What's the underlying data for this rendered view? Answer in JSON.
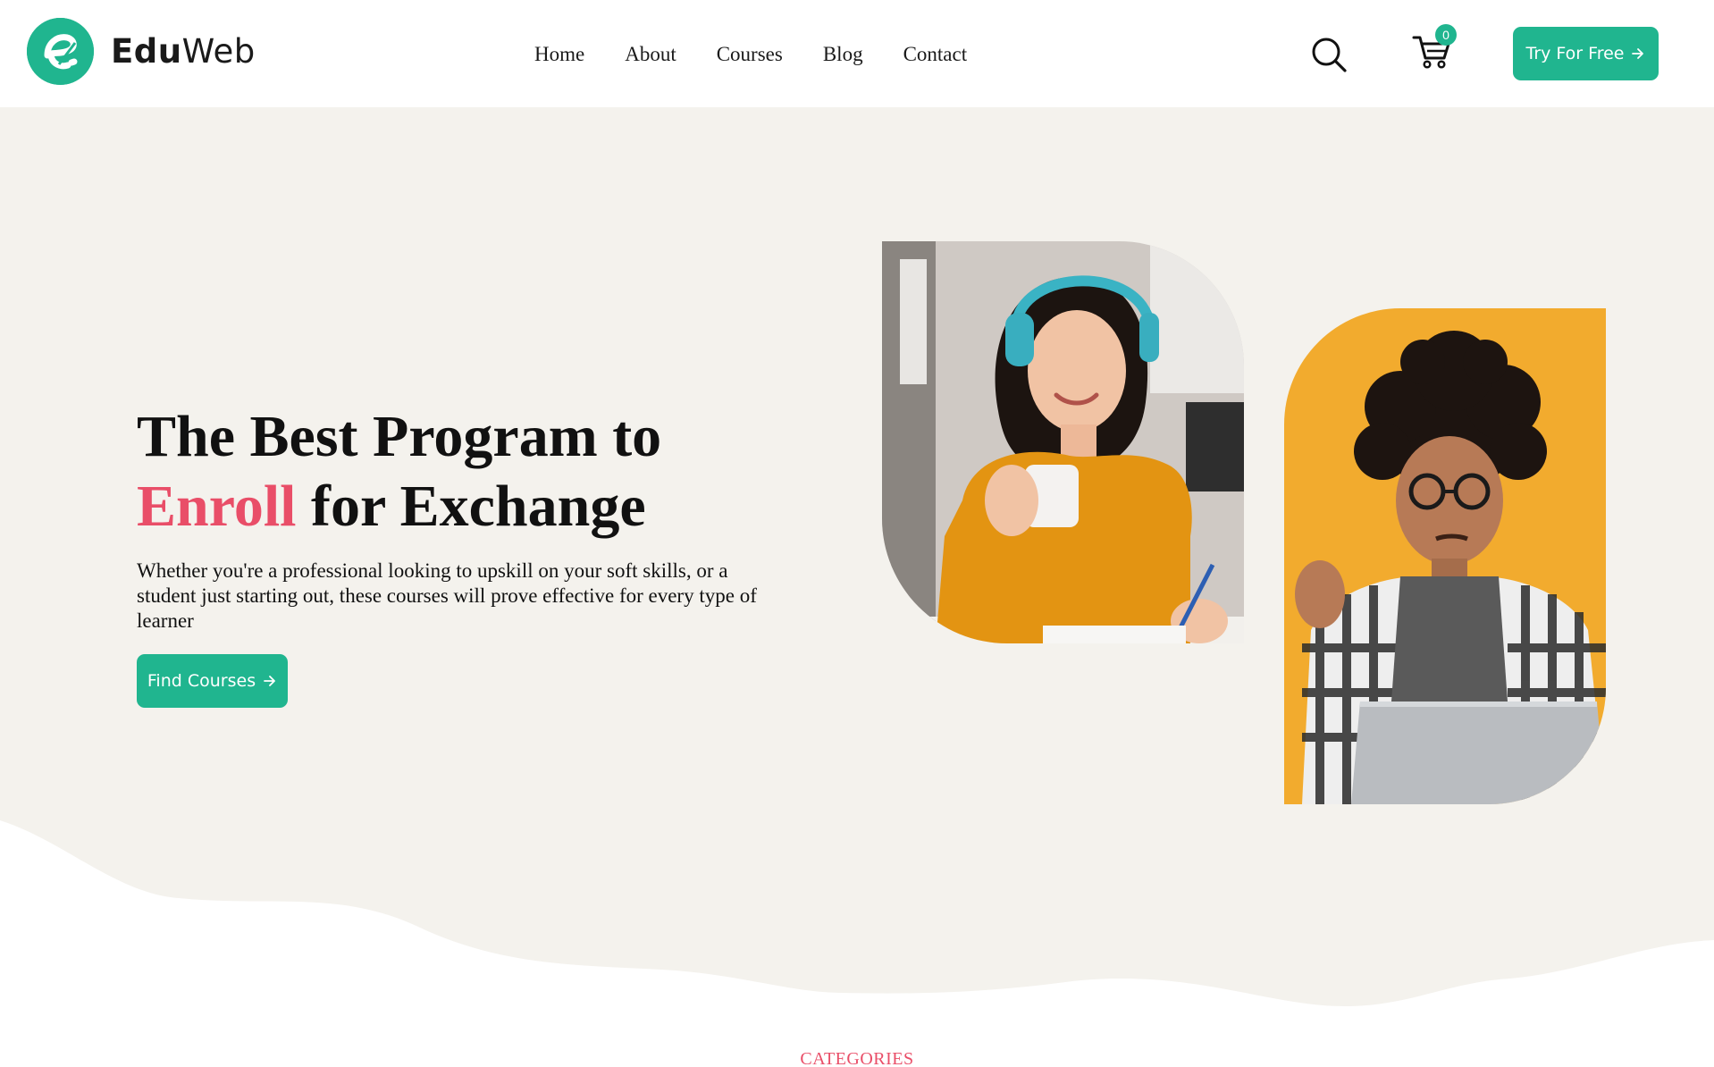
{
  "brand": {
    "name_bold": "Edu",
    "name_light": "Web",
    "logo_letter": "e",
    "accent_color": "#20b58f"
  },
  "nav": {
    "items": [
      "Home",
      "About",
      "Courses",
      "Blog",
      "Contact"
    ]
  },
  "header": {
    "search_icon": "search-icon",
    "cart_icon": "cart-icon",
    "cart_count": "0",
    "cta_label": "Try For Free",
    "cta_icon": "arrow-right-icon"
  },
  "hero": {
    "title_line1": "The Best Program to",
    "title_accent": "Enroll",
    "title_rest": " for Exchange",
    "description": "Whether you're a professional looking to upskill on your soft skills, or a student just starting out, these courses will prove effective for every type of learner",
    "button_label": "Find Courses",
    "button_icon": "arrow-right-icon",
    "accent_color": "#e94e68"
  },
  "section": {
    "label": "CATEGORIES"
  }
}
